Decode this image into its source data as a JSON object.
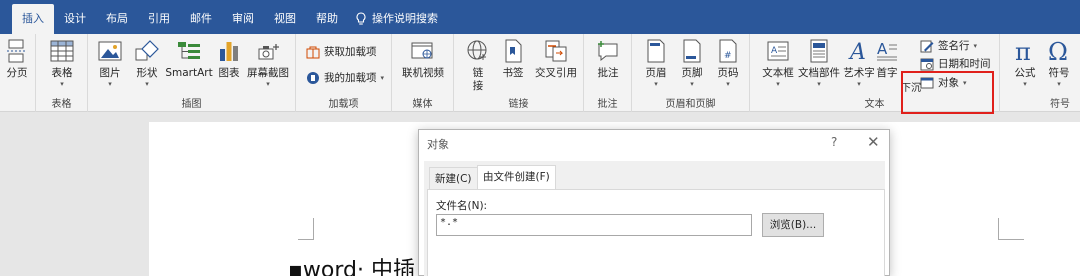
{
  "tabs": {
    "insert": "插入",
    "design": "设计",
    "layout": "布局",
    "references": "引用",
    "mailings": "邮件",
    "review": "审阅",
    "view": "视图",
    "help": "帮助",
    "tell_me": "操作说明搜索"
  },
  "ribbon": {
    "pages": {
      "page_break": "分页"
    },
    "tables": {
      "table": "表格",
      "label": "表格"
    },
    "illustrations": {
      "pictures": "图片",
      "shapes": "形状",
      "smartart": "SmartArt",
      "chart": "图表",
      "screenshot": "屏幕截图",
      "label": "插图"
    },
    "addins": {
      "get_addins": "获取加载项",
      "my_addins": "我的加载项",
      "label": "加载项"
    },
    "media": {
      "online_video": "联机视频",
      "label": "媒体"
    },
    "links": {
      "link_1": "链",
      "link_2": "接",
      "bookmark": "书签",
      "cross_ref": "交叉引用",
      "label": "链接"
    },
    "comments": {
      "comment": "批注",
      "label": "批注"
    },
    "header_footer": {
      "header": "页眉",
      "footer": "页脚",
      "page_number": "页码",
      "label": "页眉和页脚"
    },
    "text": {
      "text_box": "文本框",
      "quick_parts": "文档部件",
      "wordart": "艺术字",
      "drop_cap": "首字",
      "drop_cap_2": "下沉",
      "signature_line": "签名行",
      "date_time": "日期和时间",
      "object": "对象",
      "label": "文本"
    },
    "symbols": {
      "equation": "公式",
      "symbol": "符号",
      "label": "符号"
    }
  },
  "document": {
    "text": "▪word· 中插"
  },
  "dialog": {
    "title": "对象",
    "help": "?",
    "close": "✕",
    "tab_new": "新建(C)",
    "tab_from_file": "由文件创建(F)",
    "file_name_label": "文件名(N):",
    "file_name_value": "*.*",
    "browse": "浏览(B)..."
  },
  "colors": {
    "accent": "#2b579a",
    "highlight": "#e0201b"
  }
}
